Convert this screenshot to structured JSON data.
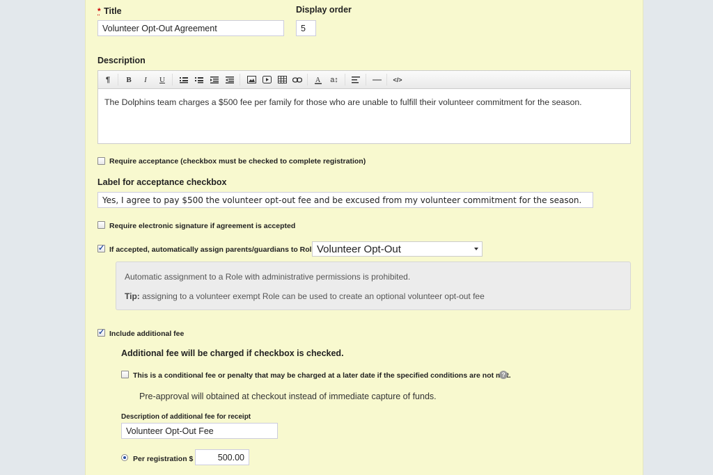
{
  "form": {
    "title_label": "Title",
    "required_mark": "*",
    "title_value": "Volunteer Opt-Out Agreement",
    "display_order_label": "Display order",
    "display_order_value": "5",
    "description_label": "Description",
    "description_text": "The Dolphins team charges a $500 fee per family for those who are unable to fulfill their volunteer commitment for the season.",
    "require_acceptance_label": "Require acceptance (checkbox must be checked to complete registration)",
    "require_acceptance_checked": false,
    "acceptance_label_heading": "Label for acceptance checkbox",
    "acceptance_label_value": "Yes, I agree to pay $500 the volunteer opt-out fee and be excused from my volunteer commitment for the season.",
    "require_signature_label": "Require electronic signature if agreement is accepted",
    "require_signature_checked": false,
    "assign_role_label": "If accepted, automatically assign parents/guardians to Role:",
    "assign_role_checked": true,
    "role_selected": "Volunteer Opt-Out",
    "note_text": "Automatic assignment to a Role with administrative permissions is prohibited.",
    "tip_label": "Tip:",
    "tip_text": "assigning to a volunteer exempt Role can be used to create an optional volunteer opt-out fee",
    "include_fee_label": "Include additional fee",
    "include_fee_checked": true,
    "fee_heading": "Additional fee will be charged if checkbox is checked.",
    "conditional_fee_label": "This is a conditional fee or penalty that may be charged at a later date if the specified conditions are not met.",
    "conditional_fee_checked": false,
    "preapproval_text": "Pre-approval will obtained at checkout instead of immediate capture of funds.",
    "fee_receipt_label": "Description of additional fee for receipt",
    "fee_receipt_value": "Volunteer Opt-Out Fee",
    "per_registration_label": "Per registration $",
    "per_registration_value": "500.00"
  },
  "toolbar": {
    "paragraph": "¶",
    "bold": "B",
    "italic": "I",
    "underline": "U",
    "font_size": "a↕",
    "code": "</>"
  },
  "colors": {
    "panel_bg": "#f8f9cf",
    "page_bg": "#e3e8ec",
    "accent": "#2a4fa0",
    "required": "#cc0000"
  }
}
